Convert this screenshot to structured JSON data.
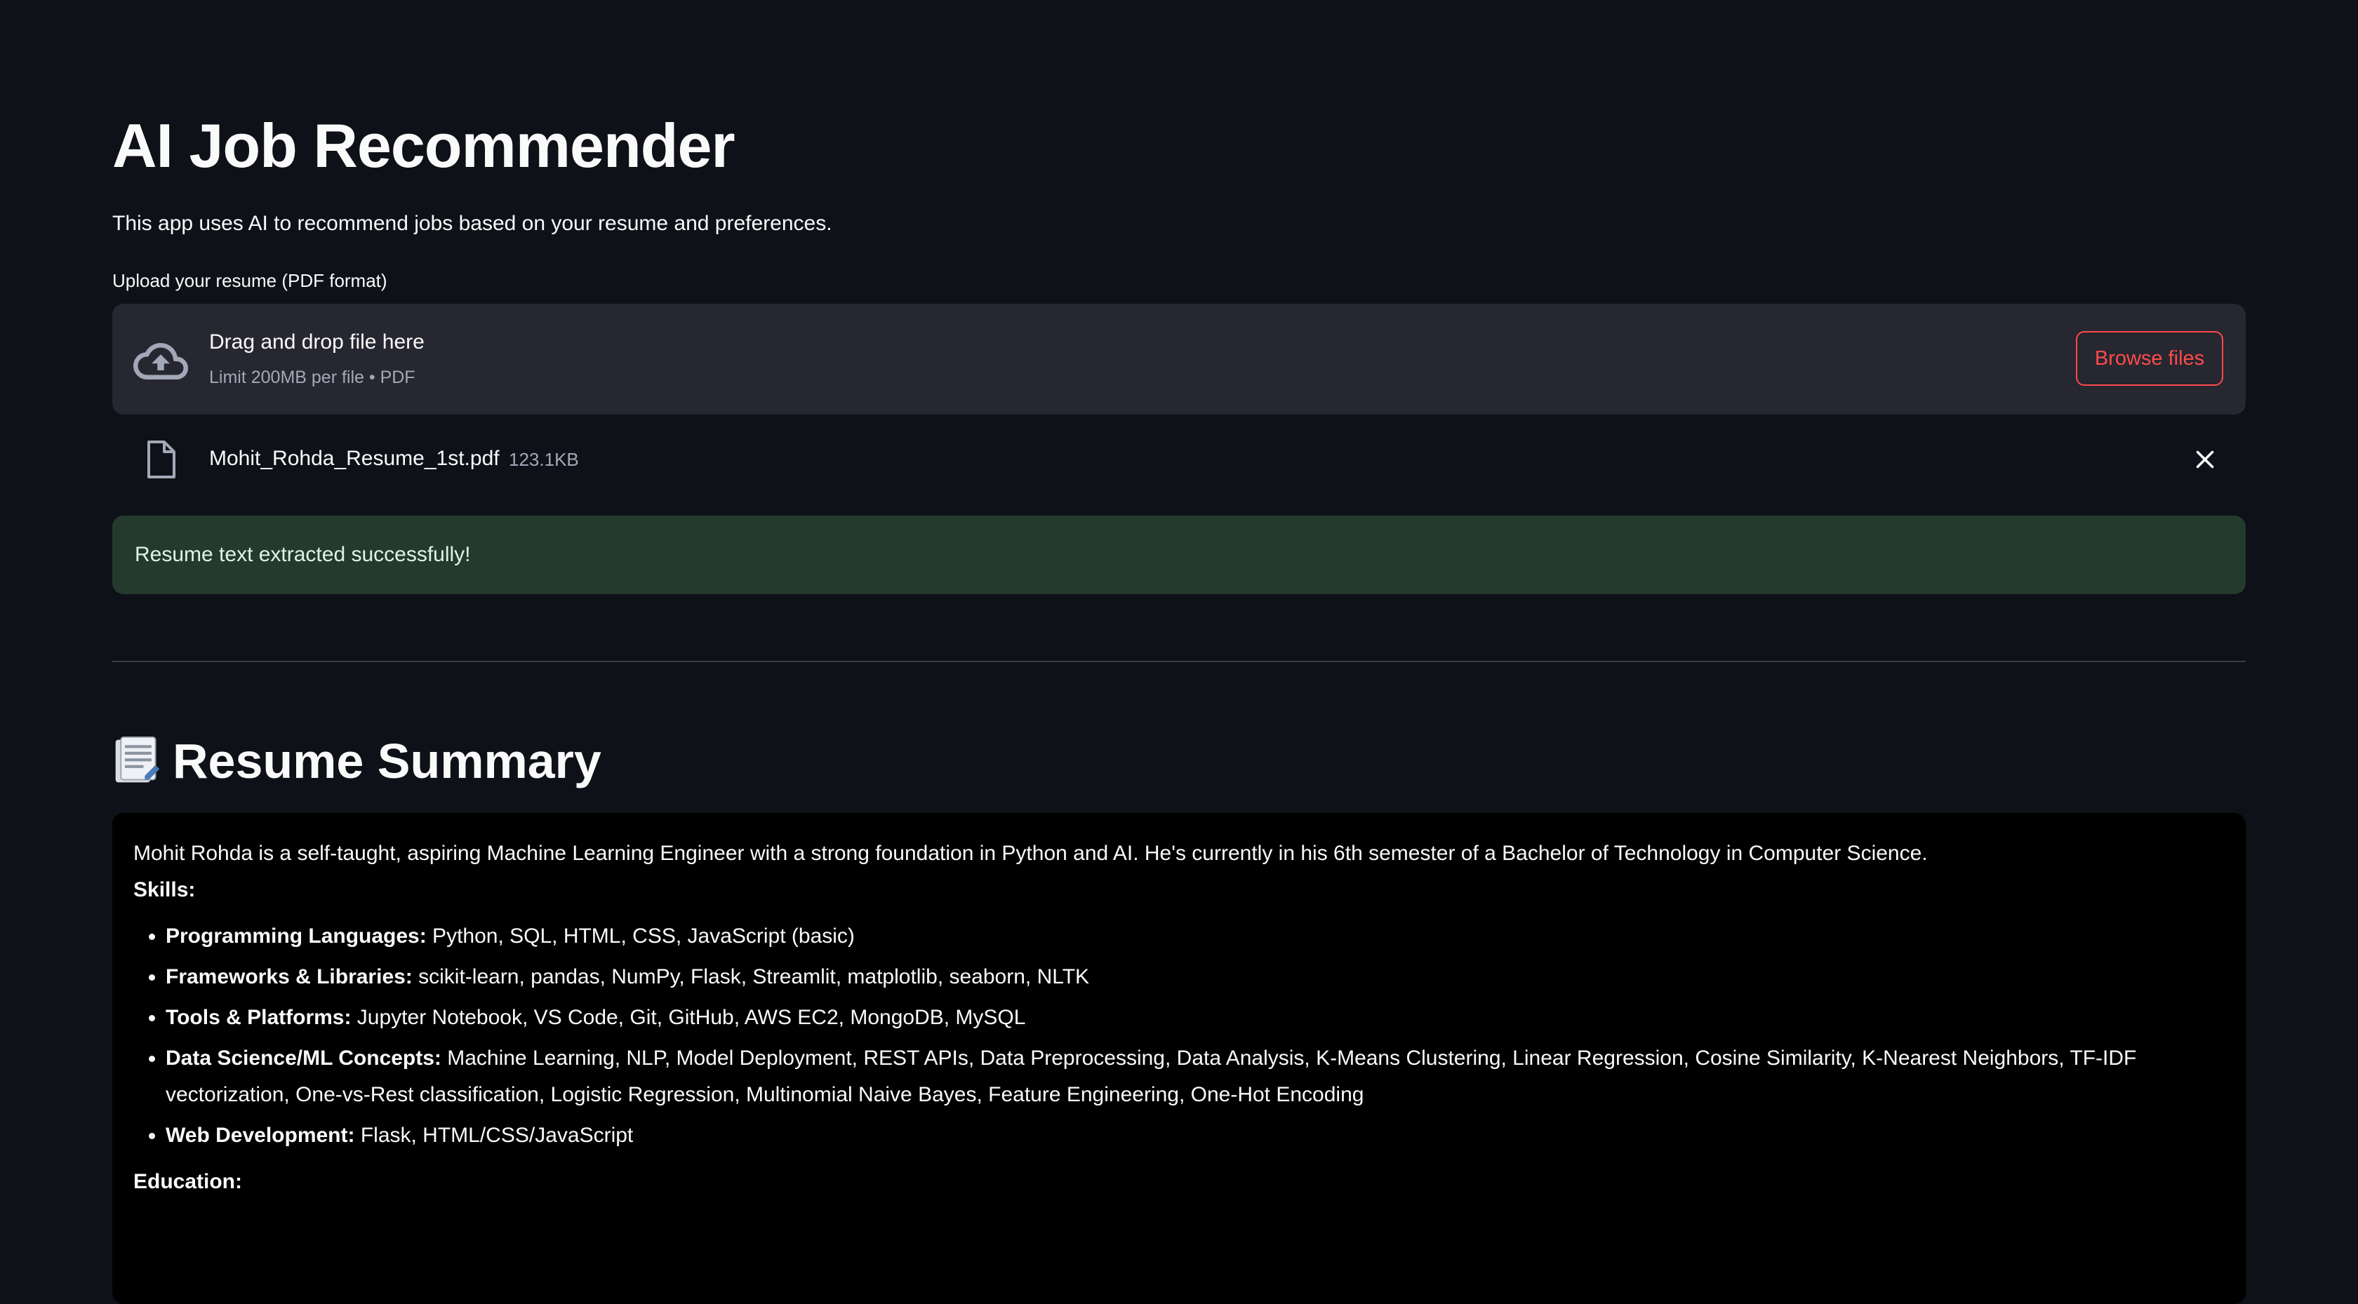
{
  "app": {
    "title": "AI Job Recommender",
    "subtitle": "This app uses AI to recommend jobs based on your resume and preferences."
  },
  "uploader": {
    "label": "Upload your resume (PDF format)",
    "drop_title": "Drag and drop file here",
    "limit_text": "Limit 200MB per file • PDF",
    "browse_label": "Browse files",
    "file": {
      "name": "Mohit_Rohda_Resume_1st.pdf",
      "size": "123.1KB"
    }
  },
  "status": {
    "success_message": "Resume text extracted successfully!"
  },
  "summary": {
    "heading": "Resume Summary",
    "icon": "memo-icon",
    "intro": "Mohit Rohda is a self-taught, aspiring Machine Learning Engineer with a strong foundation in Python and AI. He's currently in his 6th semester of a Bachelor of Technology in Computer Science.",
    "skills_label": "Skills:",
    "skills": [
      {
        "label": "Programming Languages:",
        "value": " Python, SQL, HTML, CSS, JavaScript (basic)"
      },
      {
        "label": "Frameworks & Libraries:",
        "value": " scikit-learn, pandas, NumPy, Flask, Streamlit, matplotlib, seaborn, NLTK"
      },
      {
        "label": "Tools & Platforms:",
        "value": " Jupyter Notebook, VS Code, Git, GitHub, AWS EC2, MongoDB, MySQL"
      },
      {
        "label": "Data Science/ML Concepts:",
        "value": " Machine Learning, NLP, Model Deployment, REST APIs, Data Preprocessing, Data Analysis, K-Means Clustering, Linear Regression, Cosine Similarity, K-Nearest Neighbors, TF-IDF vectorization, One-vs-Rest classification, Logistic Regression, Multinomial Naive Bayes, Feature Engineering, One-Hot Encoding"
      },
      {
        "label": "Web Development:",
        "value": " Flask, HTML/CSS/JavaScript"
      }
    ],
    "education_label": "Education:"
  },
  "colors": {
    "background": "#0e1117",
    "accent": "#ff4b4b",
    "success_bg": "#243a2d",
    "panel": "#262730"
  }
}
